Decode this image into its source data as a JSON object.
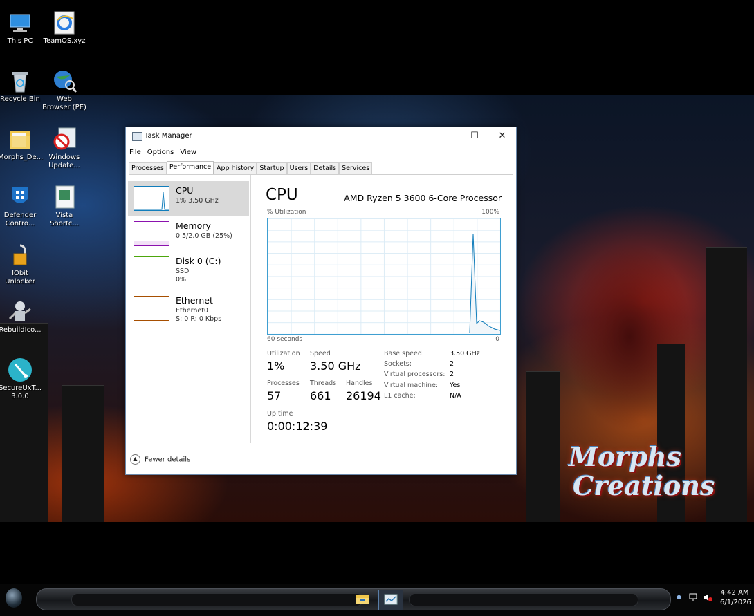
{
  "desktop": {
    "icons": [
      {
        "label": "This PC",
        "icon": "computer-icon"
      },
      {
        "label": "TeamOS.xyz",
        "icon": "internet-explorer-icon"
      },
      {
        "label": "Recycle Bin",
        "icon": "recycle-bin-icon"
      },
      {
        "label": "Web Browser (PE)",
        "icon": "globe-search-icon"
      },
      {
        "label": "Morphs_De...",
        "icon": "folder-icon"
      },
      {
        "label": "Windows Update...",
        "icon": "windows-update-blocked-icon"
      },
      {
        "label": "Defender Contro...",
        "icon": "defender-shield-icon"
      },
      {
        "label": "Vista Shortc...",
        "icon": "vista-shortcut-icon"
      },
      {
        "label": "IObit Unlocker",
        "icon": "padlock-icon"
      },
      {
        "label": "RebuildIco...",
        "icon": "robot-icon"
      },
      {
        "label": "SecureUxT... 3.0.0",
        "icon": "brush-icon"
      }
    ],
    "wallpaper_text": [
      "Morphs",
      "Creations"
    ]
  },
  "window": {
    "title": "Task Manager",
    "controls": {
      "minimize": "—",
      "maximize": "☐",
      "close": "✕"
    },
    "menu": [
      "File",
      "Options",
      "View"
    ],
    "tabs": [
      "Processes",
      "Performance",
      "App history",
      "Startup",
      "Users",
      "Details",
      "Services"
    ],
    "active_tab": "Performance",
    "resources": [
      {
        "name": "CPU",
        "line1": "1% 3.50 GHz",
        "line2": "",
        "color": "#117dbb"
      },
      {
        "name": "Memory",
        "line1": "0.5/2.0 GB (25%)",
        "line2": "",
        "color": "#8b12ae"
      },
      {
        "name": "Disk 0 (C:)",
        "line1": "SSD",
        "line2": "0%",
        "color": "#4da60c"
      },
      {
        "name": "Ethernet",
        "line1": "Ethernet0",
        "line2": "S: 0 R: 0 Kbps",
        "color": "#a74f01"
      }
    ],
    "cpu": {
      "heading": "CPU",
      "model": "AMD Ryzen 5 3600 6-Core Processor",
      "graph_label": "% Utilization",
      "graph_max": "100%",
      "graph_time": "60 seconds",
      "graph_min": "0",
      "utilization_label": "Utilization",
      "utilization": "1%",
      "speed_label": "Speed",
      "speed": "3.50 GHz",
      "processes_label": "Processes",
      "processes": "57",
      "threads_label": "Threads",
      "threads": "661",
      "handles_label": "Handles",
      "handles": "26194",
      "uptime_label": "Up time",
      "uptime": "0:00:12:39",
      "details": [
        {
          "k": "Base speed:",
          "v": "3.50 GHz"
        },
        {
          "k": "Sockets:",
          "v": "2"
        },
        {
          "k": "Virtual processors:",
          "v": "2"
        },
        {
          "k": "Virtual machine:",
          "v": "Yes"
        },
        {
          "k": "L1 cache:",
          "v": "N/A"
        }
      ]
    },
    "fewer_details": "Fewer details"
  },
  "taskbar": {
    "time": "4:42 AM",
    "date": "6/1/2026",
    "pinned": [
      "folder-icon",
      "task-manager-icon"
    ],
    "tray_icons": [
      "chevron-up-icon",
      "network-icon",
      "volume-muted-icon"
    ]
  }
}
